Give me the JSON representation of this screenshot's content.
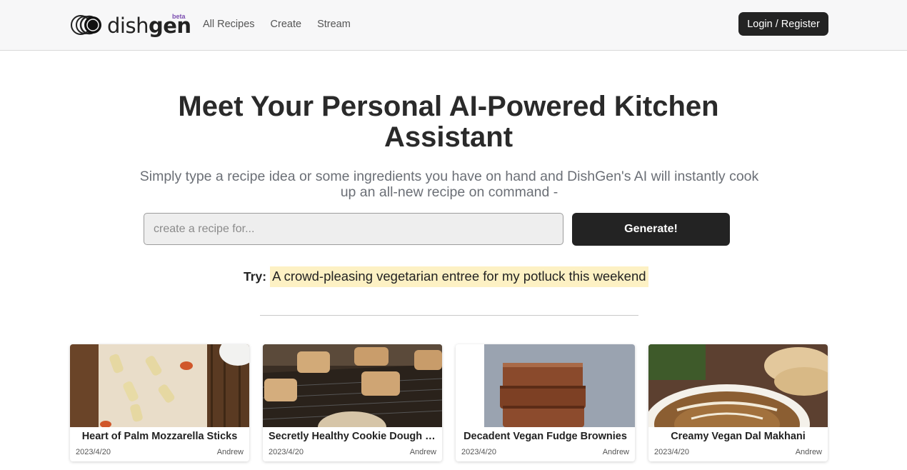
{
  "header": {
    "logo": {
      "word_light": "dish",
      "word_bold": "gen",
      "badge": "beta",
      "icon": "concentric-rings-logo-icon"
    },
    "nav": [
      "All Recipes",
      "Create",
      "Stream"
    ],
    "login_label": "Login / Register"
  },
  "hero": {
    "title": "Meet Your Personal AI-Powered Kitchen Assistant",
    "subtitle": "Simply type a recipe idea or some ingredients you have on hand and DishGen's AI will instantly cook up an all-new recipe on command -",
    "input_placeholder": "create a recipe for...",
    "input_value": "",
    "generate_label": "Generate!",
    "try_label": "Try:",
    "try_suggestion": "A crowd-pleasing vegetarian entree for my potluck this weekend"
  },
  "recipes": [
    {
      "title": "Heart of Palm Mozzarella Sticks",
      "date": "2023/4/20",
      "author": "Andrew"
    },
    {
      "title": "Secretly Healthy Cookie Dough Bites",
      "date": "2023/4/20",
      "author": "Andrew"
    },
    {
      "title": "Decadent Vegan Fudge Brownies",
      "date": "2023/4/20",
      "author": "Andrew"
    },
    {
      "title": "Creamy Vegan Dal Makhani",
      "date": "2023/4/20",
      "author": "Andrew"
    }
  ],
  "colors": {
    "accent_dark": "#232323",
    "suggestion_highlight": "#fdf1c4",
    "beta_badge": "#7b4db0"
  }
}
